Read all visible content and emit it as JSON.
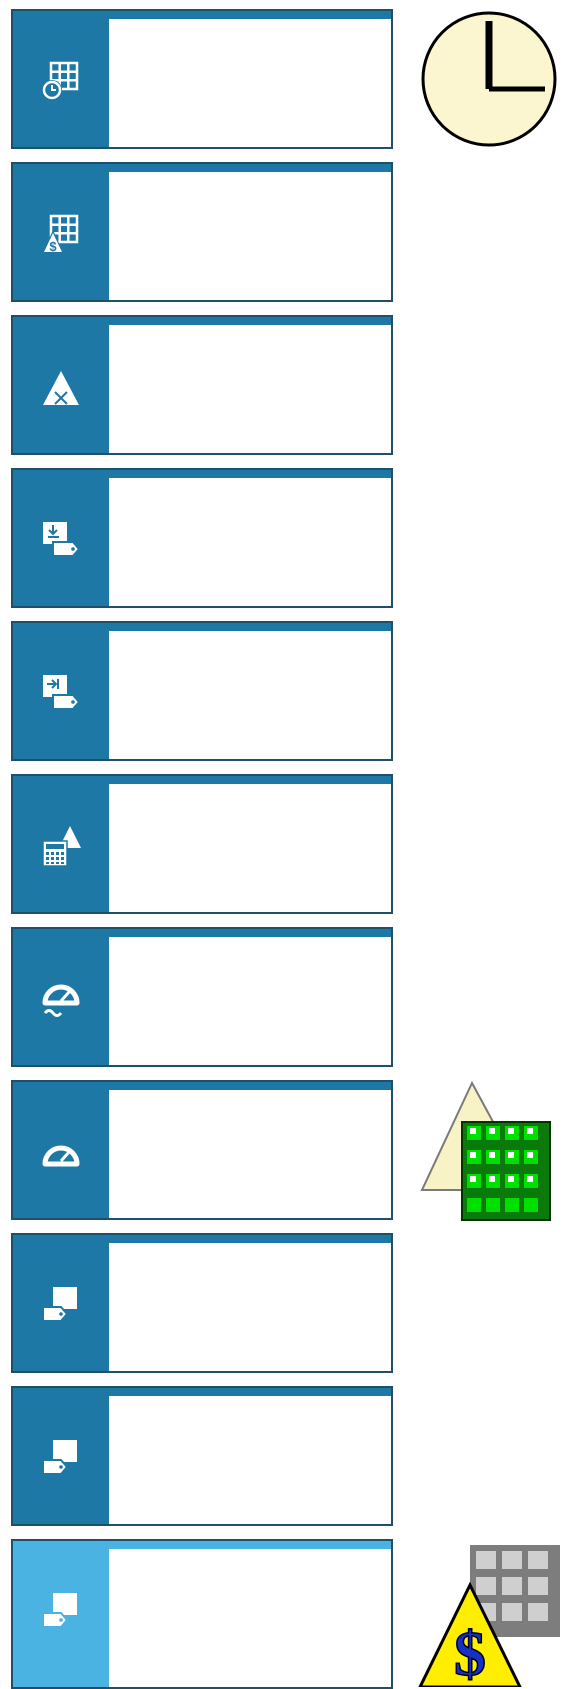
{
  "colors": {
    "tile_accent": "#1d78a5",
    "tile_accent_active": "#4bb3e2",
    "tile_border": "#1f4f6b"
  },
  "tiles": [
    {
      "icon": "calendar-grid-clock-icon"
    },
    {
      "icon": "calendar-grid-dollar-icon"
    },
    {
      "icon": "triangle-x-icon"
    },
    {
      "icon": "document-import-tag-icon"
    },
    {
      "icon": "document-arrow-tag-icon"
    },
    {
      "icon": "calculator-triangle-icon"
    },
    {
      "icon": "gauge-wave-icon"
    },
    {
      "icon": "gauge-icon"
    },
    {
      "icon": "document-tag-icon"
    },
    {
      "icon": "document-tag-icon"
    },
    {
      "icon": "document-tag-icon",
      "state": "selected"
    }
  ],
  "side_icons": [
    {
      "icon": "clock-icon"
    },
    {
      "icon": "triangle-green-grid-icon"
    },
    {
      "icon": "dollar-triangle-grid-icon"
    }
  ]
}
